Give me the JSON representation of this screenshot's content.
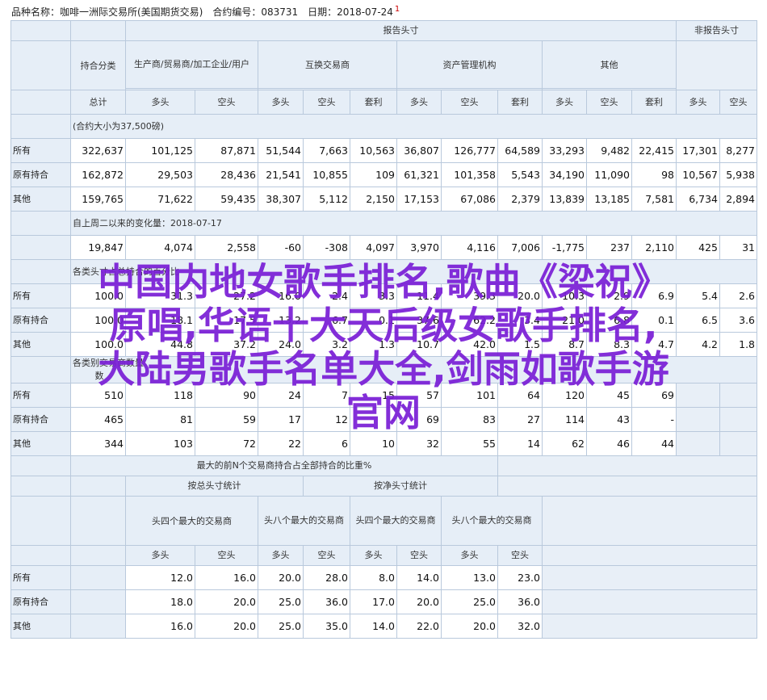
{
  "title": {
    "label": "品种名称：咖啡一洲际交易所(美国期货交易)　合约编号：083731　日期：2018-07-24",
    "mark": "1"
  },
  "header": {
    "report": "报告头寸",
    "nonreport": "非报告头寸",
    "category": "持合分类",
    "producer": "生产商/贸易商/加工企业/用户",
    "swap": "互换交易商",
    "asset": "资产管理机构",
    "other": "其他",
    "total": "总计",
    "long": "多头",
    "short": "空头",
    "spread": "套利"
  },
  "section1": {
    "label": "(合约大小为37,500磅)",
    "rows": [
      {
        "label": "所有",
        "values": [
          "322,637",
          "101,125",
          "87,871",
          "51,544",
          "7,663",
          "10,563",
          "36,807",
          "126,777",
          "64,589",
          "33,293",
          "9,482",
          "22,415",
          "17,301",
          "8,277"
        ]
      },
      {
        "label": "原有持合",
        "values": [
          "162,872",
          "29,503",
          "28,436",
          "21,541",
          "10,855",
          "109",
          "61,321",
          "101,358",
          "5,543",
          "34,190",
          "11,090",
          "98",
          "10,567",
          "5,938"
        ]
      },
      {
        "label": "其他",
        "values": [
          "159,765",
          "71,622",
          "59,435",
          "38,307",
          "5,112",
          "2,150",
          "17,153",
          "67,086",
          "2,379",
          "13,839",
          "13,185",
          "7,581",
          "6,734",
          "2,894"
        ]
      }
    ]
  },
  "section2": {
    "label": "自上周二以来的变化量：2018-07-17",
    "change": [
      "19,847",
      "4,074",
      "2,558",
      "-60",
      "-308",
      "4,097",
      "3,970",
      "4,116",
      "7,006",
      "-1,775",
      "237",
      "2,110",
      "425",
      "31"
    ],
    "sublabel": "各类头寸占总持合的百分比",
    "rows": [
      {
        "label": "所有",
        "values": [
          "100.0",
          "31.3",
          "27.2",
          "16.0",
          "2.4",
          "3.3",
          "11.4",
          "39.3",
          "20.0",
          "10.3",
          "2.9",
          "6.9",
          "5.4",
          "2.6"
        ]
      },
      {
        "label": "原有持合",
        "values": [
          "100.0",
          "18.1",
          "17.5",
          "13.2",
          "6.7",
          "0.1",
          "37.6",
          "62.2",
          "3.4",
          "21.0",
          "6.8",
          "0.1",
          "6.5",
          "3.6"
        ]
      },
      {
        "label": "其他",
        "values": [
          "100.0",
          "44.8",
          "37.2",
          "24.0",
          "3.2",
          "1.3",
          "10.7",
          "42.0",
          "1.5",
          "8.7",
          "8.3",
          "4.7",
          "4.2",
          "1.8"
        ]
      }
    ]
  },
  "section3": {
    "label_a": "各类别交易商数量",
    "label_b": "数",
    "rows": [
      {
        "label": "所有",
        "values": [
          "510",
          "118",
          "90",
          "24",
          "7",
          "15",
          "57",
          "101",
          "64",
          "120",
          "45",
          "69"
        ]
      },
      {
        "label": "原有持合",
        "values": [
          "465",
          "81",
          "59",
          "17",
          "12",
          "-",
          "69",
          "83",
          "27",
          "114",
          "43",
          "-"
        ]
      },
      {
        "label": "其他",
        "values": [
          "344",
          "103",
          "72",
          "22",
          "6",
          "10",
          "32",
          "55",
          "14",
          "62",
          "46",
          "44"
        ]
      }
    ]
  },
  "section4": {
    "title": "最大的前N个交易商持合占全部持合的比重%",
    "gross": "按总头寸统计",
    "net": "按净头寸统计",
    "top4": "头四个最大的交易商",
    "top8": "头八个最大的交易商",
    "rows": [
      {
        "label": "所有",
        "values": [
          "12.0",
          "16.0",
          "20.0",
          "28.0",
          "8.0",
          "14.0",
          "13.0",
          "23.0"
        ]
      },
      {
        "label": "原有持合",
        "values": [
          "18.0",
          "20.0",
          "25.0",
          "36.0",
          "17.0",
          "20.0",
          "25.0",
          "36.0"
        ]
      },
      {
        "label": "其他",
        "values": [
          "16.0",
          "20.0",
          "25.0",
          "35.0",
          "14.0",
          "22.0",
          "20.0",
          "32.0"
        ]
      }
    ]
  },
  "overlay": {
    "lines": [
      "中国内地女歌手排名,歌曲《梁祝》",
      "原唱,华语十大天后级女歌手排名,",
      "大陆男歌手名单大全,剑雨如歌手游",
      "官网"
    ]
  }
}
